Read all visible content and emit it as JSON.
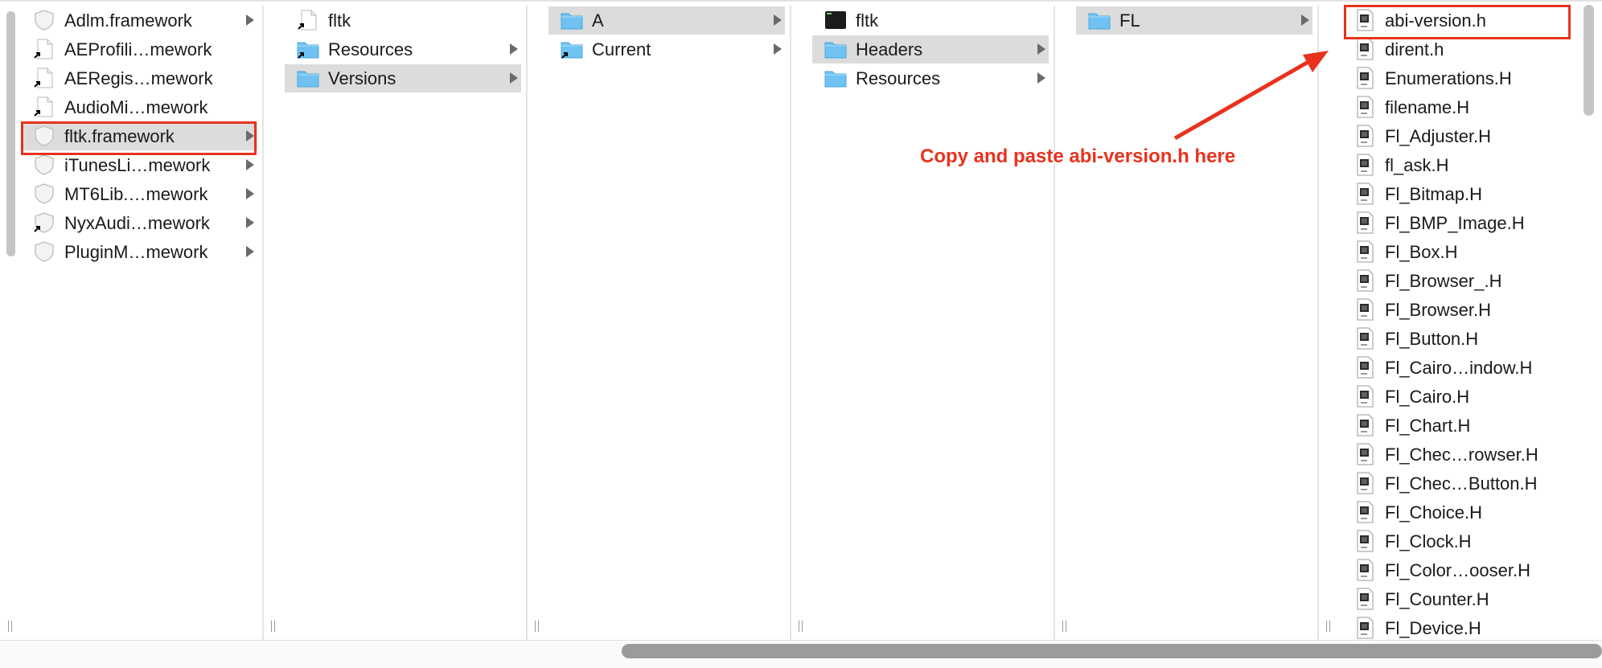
{
  "columns": [
    {
      "items": [
        {
          "label": "Adlm.framework",
          "icon": "framework-icon",
          "selected": false,
          "chevron": true
        },
        {
          "label": "AEProfili…mework",
          "icon": "alias-file-icon",
          "selected": false,
          "chevron": false
        },
        {
          "label": "AERegis…mework",
          "icon": "alias-file-icon",
          "selected": false,
          "chevron": false
        },
        {
          "label": "AudioMi…mework",
          "icon": "alias-file-icon",
          "selected": false,
          "chevron": false
        },
        {
          "label": "fltk.framework",
          "icon": "framework-icon",
          "selected": true,
          "chevron": true
        },
        {
          "label": "iTunesLi…mework",
          "icon": "framework-icon",
          "selected": false,
          "chevron": true
        },
        {
          "label": "MT6Lib.…mework",
          "icon": "framework-icon",
          "selected": false,
          "chevron": true
        },
        {
          "label": "NyxAudi…mework",
          "icon": "framework-alias-icon",
          "selected": false,
          "chevron": true
        },
        {
          "label": "PluginM…mework",
          "icon": "framework-icon",
          "selected": false,
          "chevron": true
        }
      ]
    },
    {
      "items": [
        {
          "label": "fltk",
          "icon": "alias-file-icon",
          "selected": false,
          "chevron": false
        },
        {
          "label": "Resources",
          "icon": "folder-alias-icon",
          "selected": false,
          "chevron": true
        },
        {
          "label": "Versions",
          "icon": "folder-icon",
          "selected": true,
          "chevron": true
        }
      ]
    },
    {
      "items": [
        {
          "label": "A",
          "icon": "folder-icon",
          "selected": true,
          "chevron": true
        },
        {
          "label": "Current",
          "icon": "folder-alias-icon",
          "selected": false,
          "chevron": true
        }
      ]
    },
    {
      "items": [
        {
          "label": "fltk",
          "icon": "exec-icon",
          "selected": false,
          "chevron": false
        },
        {
          "label": "Headers",
          "icon": "folder-icon",
          "selected": true,
          "chevron": true
        },
        {
          "label": "Resources",
          "icon": "folder-icon",
          "selected": false,
          "chevron": true
        }
      ]
    },
    {
      "items": [
        {
          "label": "FL",
          "icon": "folder-icon",
          "selected": true,
          "chevron": true
        }
      ]
    },
    {
      "items": [
        {
          "label": "abi-version.h",
          "icon": "header-file-icon",
          "selected": false,
          "chevron": false
        },
        {
          "label": "dirent.h",
          "icon": "header-file-icon",
          "selected": false,
          "chevron": false
        },
        {
          "label": "Enumerations.H",
          "icon": "header-file-icon",
          "selected": false,
          "chevron": false
        },
        {
          "label": "filename.H",
          "icon": "header-file-icon",
          "selected": false,
          "chevron": false
        },
        {
          "label": "Fl_Adjuster.H",
          "icon": "header-file-icon",
          "selected": false,
          "chevron": false
        },
        {
          "label": "fl_ask.H",
          "icon": "header-file-icon",
          "selected": false,
          "chevron": false
        },
        {
          "label": "Fl_Bitmap.H",
          "icon": "header-file-icon",
          "selected": false,
          "chevron": false
        },
        {
          "label": "Fl_BMP_Image.H",
          "icon": "header-file-icon",
          "selected": false,
          "chevron": false
        },
        {
          "label": "Fl_Box.H",
          "icon": "header-file-icon",
          "selected": false,
          "chevron": false
        },
        {
          "label": "Fl_Browser_.H",
          "icon": "header-file-icon",
          "selected": false,
          "chevron": false
        },
        {
          "label": "Fl_Browser.H",
          "icon": "header-file-icon",
          "selected": false,
          "chevron": false
        },
        {
          "label": "Fl_Button.H",
          "icon": "header-file-icon",
          "selected": false,
          "chevron": false
        },
        {
          "label": "Fl_Cairo…indow.H",
          "icon": "header-file-icon",
          "selected": false,
          "chevron": false
        },
        {
          "label": "Fl_Cairo.H",
          "icon": "header-file-icon",
          "selected": false,
          "chevron": false
        },
        {
          "label": "Fl_Chart.H",
          "icon": "header-file-icon",
          "selected": false,
          "chevron": false
        },
        {
          "label": "Fl_Chec…rowser.H",
          "icon": "header-file-icon",
          "selected": false,
          "chevron": false
        },
        {
          "label": "Fl_Chec…Button.H",
          "icon": "header-file-icon",
          "selected": false,
          "chevron": false
        },
        {
          "label": "Fl_Choice.H",
          "icon": "header-file-icon",
          "selected": false,
          "chevron": false
        },
        {
          "label": "Fl_Clock.H",
          "icon": "header-file-icon",
          "selected": false,
          "chevron": false
        },
        {
          "label": "Fl_Color…ooser.H",
          "icon": "header-file-icon",
          "selected": false,
          "chevron": false
        },
        {
          "label": "Fl_Counter.H",
          "icon": "header-file-icon",
          "selected": false,
          "chevron": false
        },
        {
          "label": "Fl_Device.H",
          "icon": "header-file-icon",
          "selected": false,
          "chevron": false
        }
      ]
    }
  ],
  "annotation": {
    "text": "Copy and paste abi-version.h here",
    "color": "#e8321e"
  },
  "colors": {
    "selection": "#dcdcdc",
    "folder": "#6fc2f1",
    "highlight_box": "#e8321e"
  }
}
